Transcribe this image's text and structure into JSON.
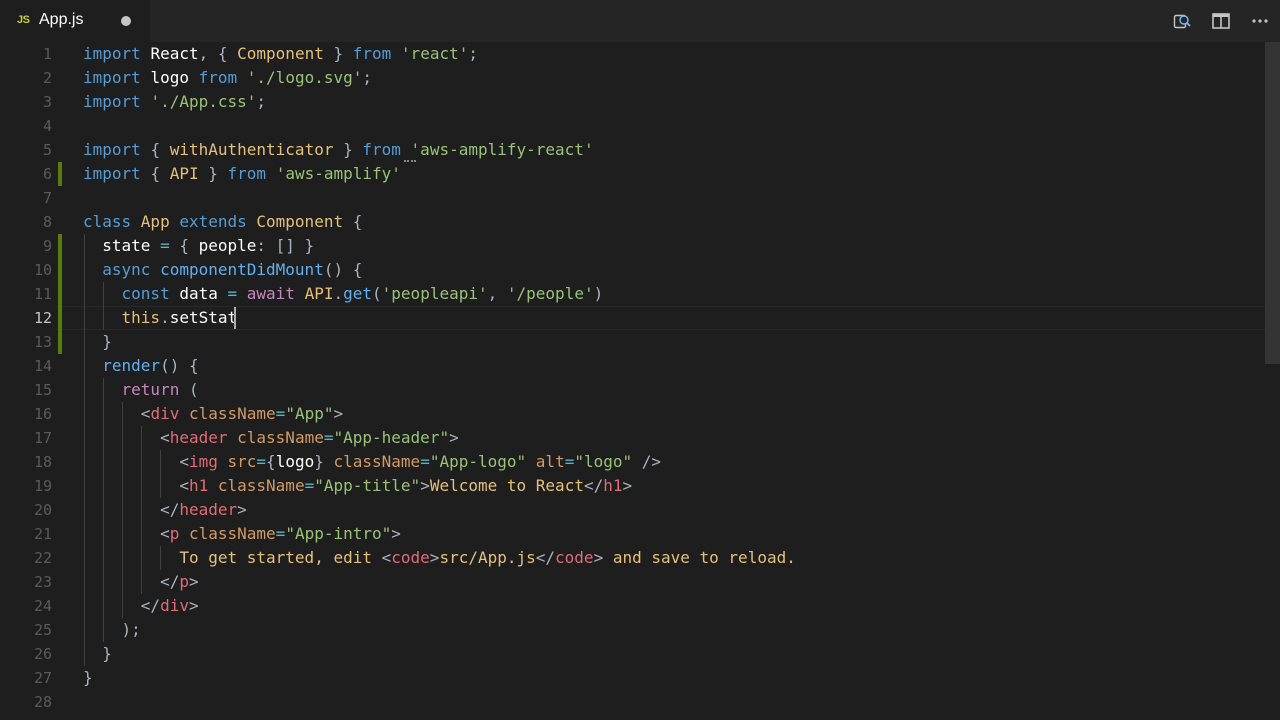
{
  "tab": {
    "icon": "JS",
    "title": "App.js",
    "dirty": true
  },
  "actions": [
    {
      "name": "open-changes-icon"
    },
    {
      "name": "split-editor-icon"
    },
    {
      "name": "more-actions-icon"
    }
  ],
  "editor": {
    "active_line": 12,
    "line_numbers": [
      "1",
      "2",
      "3",
      "4",
      "5",
      "6",
      "7",
      "8",
      "9",
      "10",
      "11",
      "12",
      "13",
      "14",
      "15",
      "16",
      "17",
      "18",
      "19",
      "20",
      "21",
      "22",
      "23",
      "24",
      "25",
      "26",
      "27",
      "28"
    ],
    "lines": [
      [
        [
          "kb",
          "import "
        ],
        [
          "id",
          "React"
        ],
        [
          "p",
          ", { "
        ],
        [
          "c",
          "Component"
        ],
        [
          "p",
          " } "
        ],
        [
          "kb",
          "from "
        ],
        [
          "s",
          "'react'"
        ],
        [
          "p",
          ";"
        ]
      ],
      [
        [
          "kb",
          "import "
        ],
        [
          "id",
          "logo "
        ],
        [
          "kb",
          "from "
        ],
        [
          "s",
          "'./logo.svg'"
        ],
        [
          "p",
          ";"
        ]
      ],
      [
        [
          "kb",
          "import "
        ],
        [
          "s",
          "'./App.css'"
        ],
        [
          "p",
          ";"
        ]
      ],
      [],
      [
        [
          "kb",
          "import "
        ],
        [
          "p",
          "{ "
        ],
        [
          "c",
          "withAuthenticator"
        ],
        [
          "p",
          " } "
        ],
        [
          "kb",
          "from "
        ],
        [
          "s",
          "'aws-amplify-react'"
        ]
      ],
      [
        [
          "kb",
          "import "
        ],
        [
          "p",
          "{ "
        ],
        [
          "c",
          "API"
        ],
        [
          "p",
          " } "
        ],
        [
          "kb",
          "from "
        ],
        [
          "s",
          "'aws-amplify'"
        ]
      ],
      [],
      [
        [
          "kb",
          "class "
        ],
        [
          "c",
          "App "
        ],
        [
          "kb",
          "extends "
        ],
        [
          "c",
          "Component"
        ],
        [
          "p",
          " {"
        ]
      ],
      [
        [
          "id",
          "  state "
        ],
        [
          "op",
          "= "
        ],
        [
          "p",
          "{ "
        ],
        [
          "id",
          "people"
        ],
        [
          "p",
          ": [] }"
        ]
      ],
      [
        [
          "kb",
          "  async "
        ],
        [
          "f",
          "componentDidMount"
        ],
        [
          "p",
          "() {"
        ]
      ],
      [
        [
          "kb",
          "    const "
        ],
        [
          "id",
          "data "
        ],
        [
          "op",
          "= "
        ],
        [
          "k",
          "await "
        ],
        [
          "c",
          "API"
        ],
        [
          "p",
          "."
        ],
        [
          "f",
          "get"
        ],
        [
          "p",
          "("
        ],
        [
          "s",
          "'peopleapi'"
        ],
        [
          "p",
          ", "
        ],
        [
          "s",
          "'/people'"
        ],
        [
          "p",
          ")"
        ]
      ],
      [
        [
          "th",
          "    this"
        ],
        [
          "p",
          "."
        ],
        [
          "id",
          "setStat"
        ]
      ],
      [
        [
          "p",
          "  }"
        ]
      ],
      [
        [
          "f",
          "  render"
        ],
        [
          "p",
          "() {"
        ]
      ],
      [
        [
          "k",
          "    return "
        ],
        [
          "p",
          "("
        ]
      ],
      [
        [
          "p",
          "      <"
        ],
        [
          "t",
          "div "
        ],
        [
          "a",
          "className"
        ],
        [
          "op",
          "="
        ],
        [
          "s",
          "\"App\""
        ],
        [
          "p",
          ">"
        ]
      ],
      [
        [
          "p",
          "        <"
        ],
        [
          "t",
          "header "
        ],
        [
          "a",
          "className"
        ],
        [
          "op",
          "="
        ],
        [
          "s",
          "\"App-header\""
        ],
        [
          "p",
          ">"
        ]
      ],
      [
        [
          "p",
          "          <"
        ],
        [
          "t",
          "img "
        ],
        [
          "a",
          "src"
        ],
        [
          "op",
          "="
        ],
        [
          "p",
          "{"
        ],
        [
          "id",
          "logo"
        ],
        [
          "p",
          "} "
        ],
        [
          "a",
          "className"
        ],
        [
          "op",
          "="
        ],
        [
          "s",
          "\"App-logo\" "
        ],
        [
          "a",
          "alt"
        ],
        [
          "op",
          "="
        ],
        [
          "s",
          "\"logo\""
        ],
        [
          "p",
          " />"
        ]
      ],
      [
        [
          "p",
          "          <"
        ],
        [
          "t",
          "h1 "
        ],
        [
          "a",
          "className"
        ],
        [
          "op",
          "="
        ],
        [
          "s",
          "\"App-title\""
        ],
        [
          "p",
          ">"
        ],
        [
          "tx",
          "Welcome to React"
        ],
        [
          "p",
          "</"
        ],
        [
          "t",
          "h1"
        ],
        [
          "p",
          ">"
        ]
      ],
      [
        [
          "p",
          "        </"
        ],
        [
          "t",
          "header"
        ],
        [
          "p",
          ">"
        ]
      ],
      [
        [
          "p",
          "        <"
        ],
        [
          "t",
          "p "
        ],
        [
          "a",
          "className"
        ],
        [
          "op",
          "="
        ],
        [
          "s",
          "\"App-intro\""
        ],
        [
          "p",
          ">"
        ]
      ],
      [
        [
          "tx",
          "          To get started, edit "
        ],
        [
          "p",
          "<"
        ],
        [
          "t",
          "code"
        ],
        [
          "p",
          ">"
        ],
        [
          "tx",
          "src/App.js"
        ],
        [
          "p",
          "</"
        ],
        [
          "t",
          "code"
        ],
        [
          "p",
          "> "
        ],
        [
          "tx",
          "and save to reload."
        ]
      ],
      [
        [
          "p",
          "        </"
        ],
        [
          "t",
          "p"
        ],
        [
          "p",
          ">"
        ]
      ],
      [
        [
          "p",
          "      </"
        ],
        [
          "t",
          "div"
        ],
        [
          "p",
          ">"
        ]
      ],
      [
        [
          "p",
          "    );"
        ]
      ],
      [
        [
          "p",
          "  }"
        ]
      ],
      [
        [
          "p",
          "}"
        ]
      ],
      []
    ]
  },
  "colors": {
    "background": "#1e1e1e",
    "tabbar": "#252526",
    "modified_gutter": "#587c0c",
    "js_icon": "#cbcb41"
  }
}
